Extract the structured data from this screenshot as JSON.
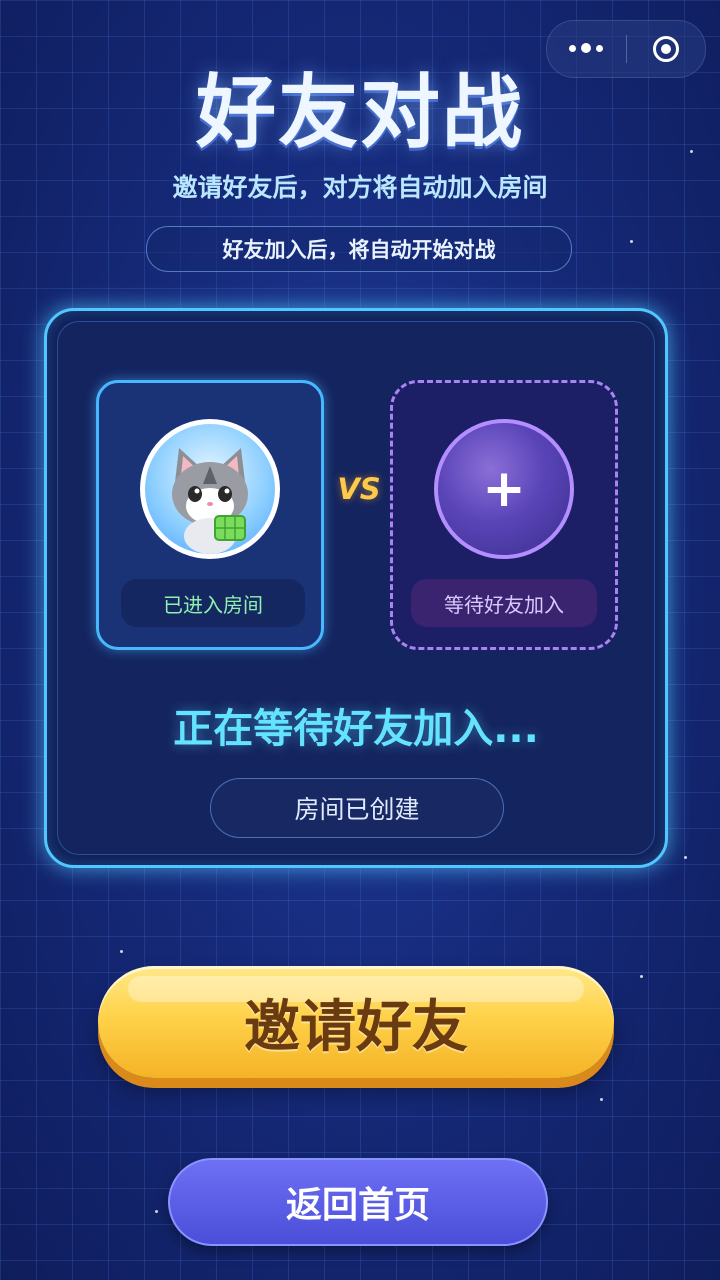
{
  "header": {
    "title": "好友对战",
    "subtitle": "邀请好友后，对方将自动加入房间",
    "note": "好友加入后，将自动开始对战"
  },
  "capsule": {
    "menu_icon": "more-dots-icon",
    "close_icon": "target-circle-icon"
  },
  "room": {
    "player_status": "已进入房间",
    "vs_label": "VS",
    "invite_slot_symbol": "+",
    "waiting_label": "等待好友加入",
    "status_text": "正在等待好友加入...",
    "room_state": "房间已创建"
  },
  "actions": {
    "invite_label": "邀请好友",
    "home_label": "返回首页"
  },
  "colors": {
    "background": "#162a7a",
    "panel_border": "#52c6ff",
    "status_text": "#63e3ff",
    "invite_button": "#ffd24a",
    "home_button": "#5a5ee6",
    "vs": "#ffc94a"
  }
}
